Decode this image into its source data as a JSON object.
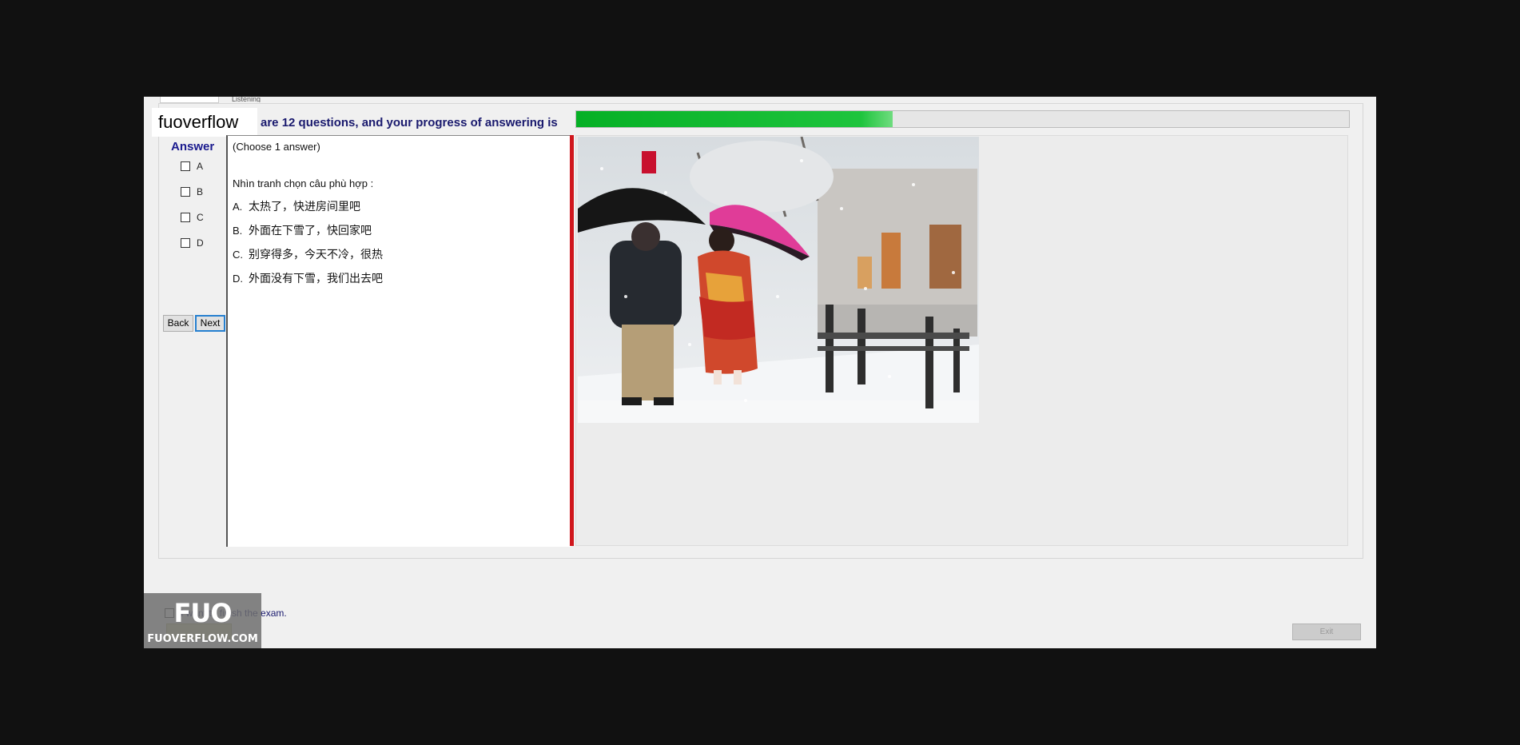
{
  "tabs": [
    "",
    "Listening"
  ],
  "watermark_text": "fuoverflow",
  "progress": {
    "text": "are 12 questions, and your progress of answering is",
    "fraction": 0.41
  },
  "answer_panel": {
    "heading": "Answer",
    "options": [
      "A",
      "B",
      "C",
      "D"
    ],
    "back_label": "Back",
    "next_label": "Next"
  },
  "question": {
    "hint": "(Choose 1 answer)",
    "text": "Nhìn tranh chọn câu phù hợp :",
    "choices": [
      {
        "letter": "A.",
        "text": "太热了，快进房间里吧"
      },
      {
        "letter": "B.",
        "text": "外面在下雪了，快回家吧"
      },
      {
        "letter": "C.",
        "text": "别穿得多，今天不冷，很热"
      },
      {
        "letter": "D.",
        "text": "外面没有下雪，我们出去吧"
      }
    ]
  },
  "footer": {
    "finish_label": "I want to finish the exam.",
    "exit_label": "Exit"
  },
  "logo": {
    "mark": "FUO",
    "site": "FUOVERFLOW.COM"
  },
  "colors": {
    "progress_fill": "#06b025",
    "splitter": "#d0161c",
    "heading_blue": "#1a1a8e"
  }
}
